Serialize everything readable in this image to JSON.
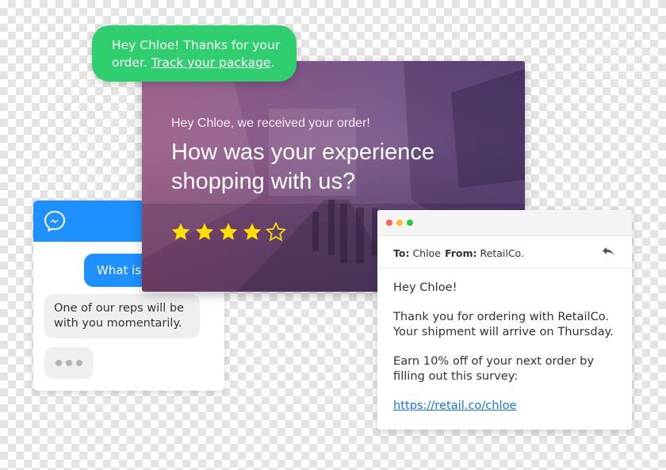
{
  "messenger": {
    "outgoing_message": "What is",
    "incoming_message": "One of our reps will be with you momentarily.",
    "icon": "messenger-icon",
    "header_color": "#1e90ff"
  },
  "sms": {
    "text_before": "Hey Chloe! Thanks for your order. ",
    "link_text": "Track your package",
    "text_after": ".",
    "color": "#2fcf6f"
  },
  "survey": {
    "subtitle": "Hey Chloe, we received your order!",
    "title": "How was your experience shopping with us?",
    "rating": 4,
    "max_rating": 5,
    "star_color": "#ffe000"
  },
  "email": {
    "to_label": "To:",
    "to_value": "Chloe",
    "from_label": "From:",
    "from_value": "RetailCo.",
    "greeting": "Hey Chloe!",
    "paragraph1": "Thank you for ordering with RetailCo. Your shipment will arrive on Thursday.",
    "paragraph2": "Earn 10% off of your next order by filling out this survey:",
    "link": "https://retail.co/chloe",
    "link_color": "#1a73e8"
  }
}
